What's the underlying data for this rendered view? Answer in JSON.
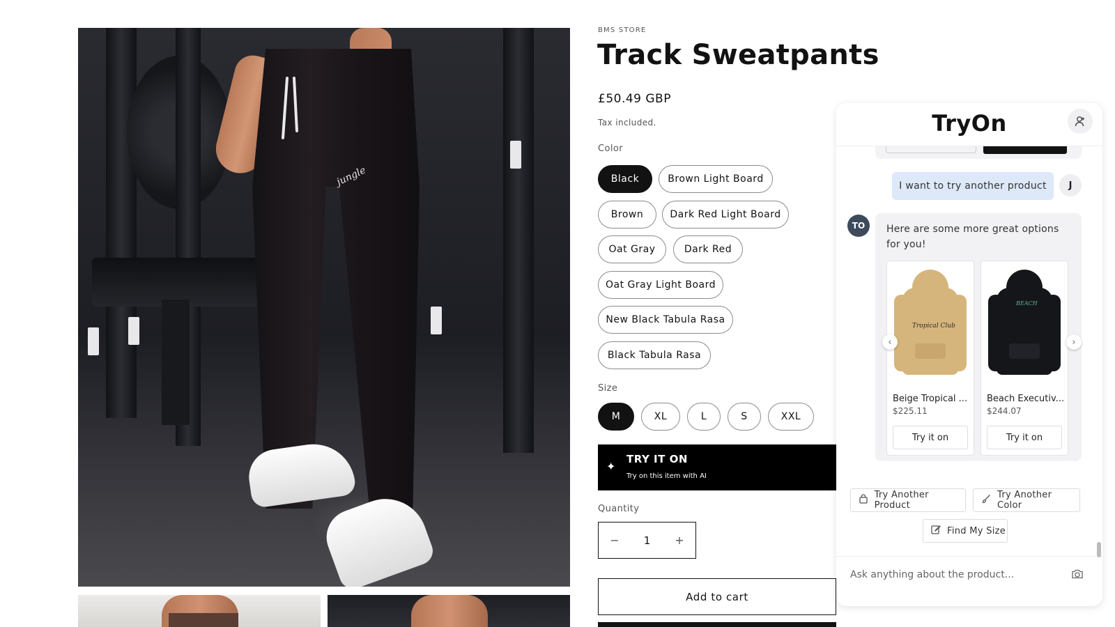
{
  "product": {
    "vendor": "BMS STORE",
    "title": "Track Sweatpants",
    "price": "£50.49 GBP",
    "tax_note": "Tax included.",
    "color_label": "Color",
    "colors": [
      "Black",
      "Brown Light Board",
      "Brown",
      "Dark Red Light Board",
      "Oat Gray",
      "Dark Red",
      "Oat Gray Light Board",
      "New Black Tabula Rasa",
      "Black Tabula Rasa"
    ],
    "selected_color": "Black",
    "size_label": "Size",
    "sizes": [
      "M",
      "XL",
      "L",
      "S",
      "XXL"
    ],
    "selected_size": "M",
    "try_it_on": {
      "title": "TRY IT ON",
      "subtitle": "Try on this item with AI"
    },
    "quantity_label": "Quantity",
    "quantity": "1",
    "minus": "−",
    "plus": "+",
    "add_to_cart": "Add to cart"
  },
  "gallery": {
    "main_logo_script": "jungle"
  },
  "widget": {
    "title": "TryOn",
    "profile_icon": "user-icon",
    "user_message": "I want to try another product",
    "user_initial": "J",
    "bot_initials": "TO",
    "bot_message": "Here are some more great options for you!",
    "products": [
      {
        "name": "Beige Tropical ...",
        "price": "$225.11",
        "button": "Try it on",
        "print": "Tropical Club"
      },
      {
        "name": "Beach Executiv...",
        "price": "$244.07",
        "button": "Try it on",
        "print": "BEACH"
      }
    ],
    "quick_actions": [
      {
        "label": "Try Another Product",
        "icon": "bag-icon"
      },
      {
        "label": "Try Another Color",
        "icon": "brush-icon"
      },
      {
        "label": "Find My Size",
        "icon": "edit-icon"
      }
    ],
    "input_placeholder": "Ask anything about the product...",
    "camera_icon": "camera-icon"
  },
  "colors": {
    "selected_pill": "#121212",
    "user_bubble": "#dde8f8",
    "bot_avatar": "#3d4a5c",
    "try_on_banner": "#000000"
  }
}
